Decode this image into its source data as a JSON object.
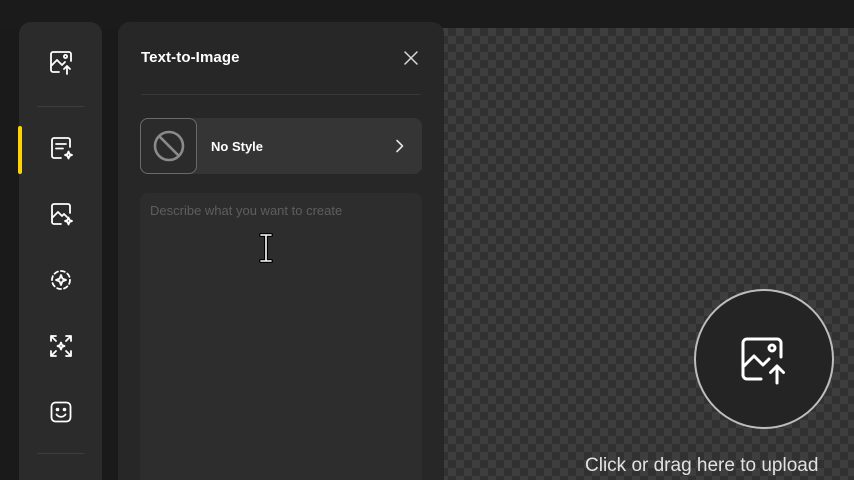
{
  "panel": {
    "title": "Text-to-Image",
    "style_selector": {
      "label": "No Style"
    },
    "prompt": {
      "placeholder": "Describe what you want to create",
      "value": ""
    }
  },
  "sidebar": {
    "items": [
      {
        "icon": "image-upload-icon",
        "active": false
      },
      {
        "icon": "text-to-image-icon",
        "active": true
      },
      {
        "icon": "image-to-image-icon",
        "active": false
      },
      {
        "icon": "sparkle-circle-icon",
        "active": false
      },
      {
        "icon": "expand-sparkle-icon",
        "active": false
      },
      {
        "icon": "face-icon",
        "active": false
      }
    ]
  },
  "canvas": {
    "upload_text": "Click or drag here to upload"
  },
  "colors": {
    "accent": "#ffd200",
    "panel_bg": "#272727",
    "rail_bg": "#2b2b2b"
  }
}
